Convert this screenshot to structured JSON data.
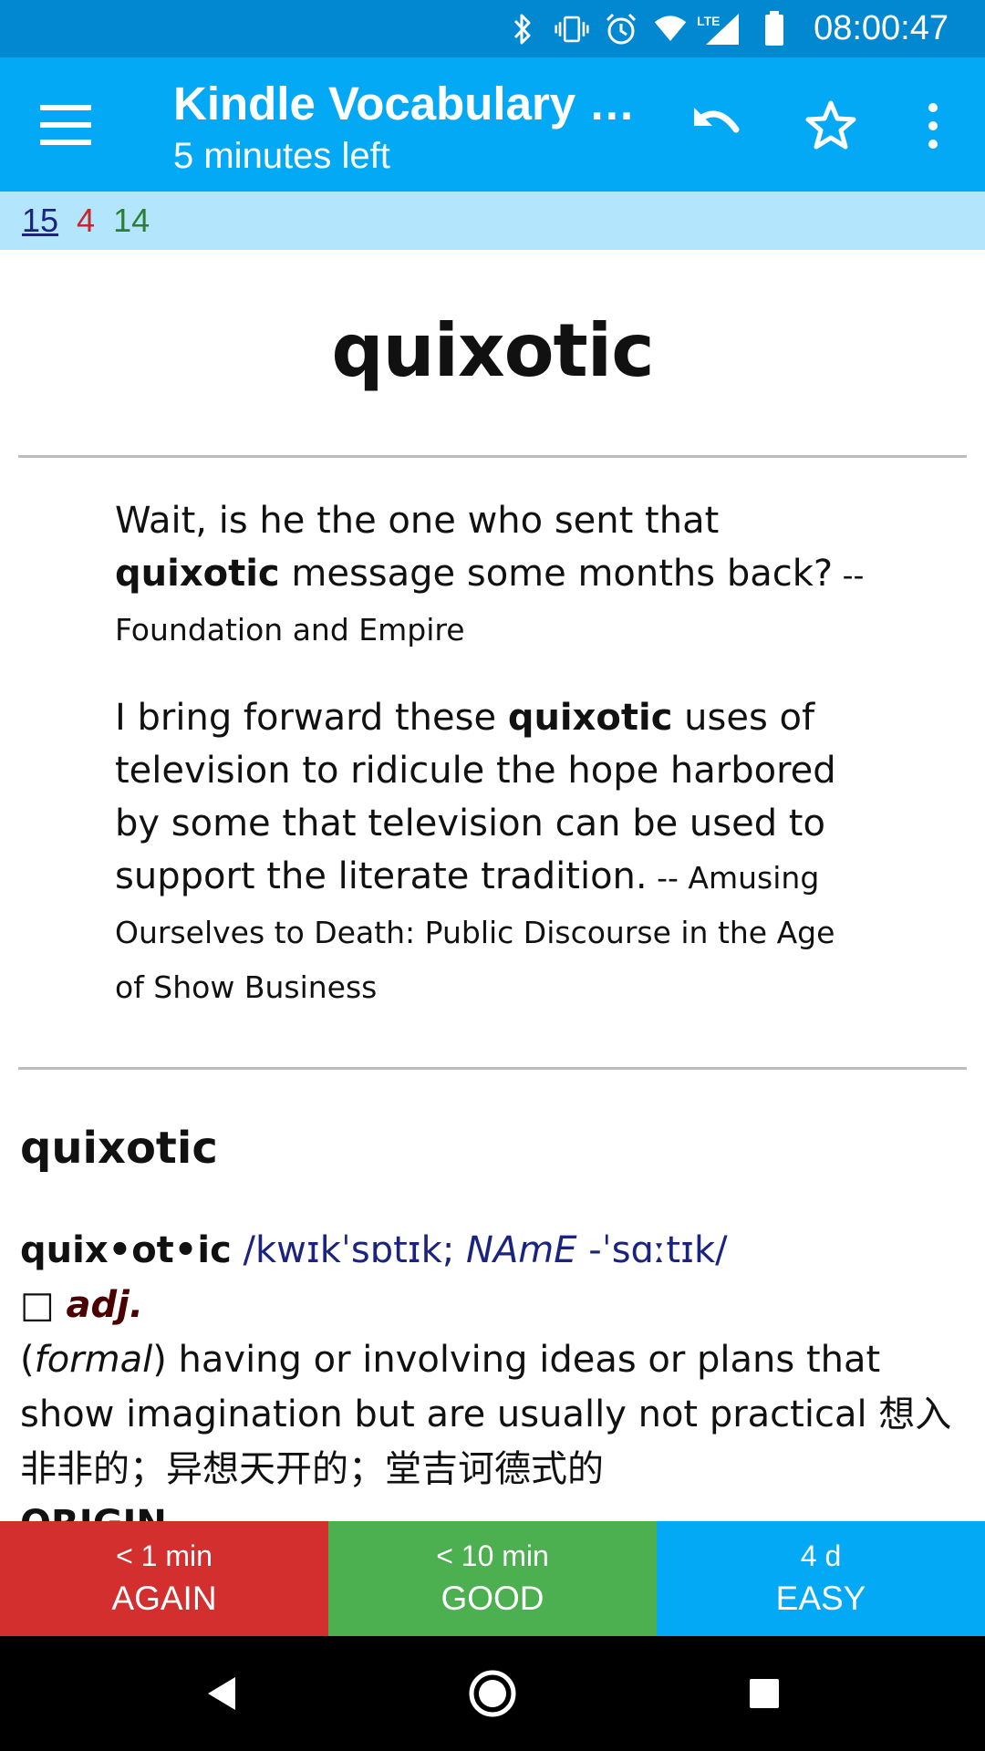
{
  "status_bar": {
    "time": "08:00:47",
    "icons": [
      "bluetooth-icon",
      "vibrate-icon",
      "alarm-icon",
      "wifi-icon",
      "lte-signal-icon",
      "battery-icon"
    ],
    "network_label": "LTE"
  },
  "app_bar": {
    "title": "Kindle Vocabulary B…",
    "subtitle": "5 minutes left",
    "icons": [
      "menu-icon",
      "undo-icon",
      "star-icon",
      "more-vert-icon"
    ]
  },
  "counts": {
    "new": "15",
    "learning": "4",
    "review": "14"
  },
  "card": {
    "word": "quixotic",
    "examples": [
      {
        "before": "Wait, is he the one who sent that ",
        "bold": "quixotic",
        "after": " message some months back?",
        "source": " -- Foundation and Empire"
      },
      {
        "before": "I bring forward these ",
        "bold": "quixotic",
        "after": " uses of television to ridicule the hope harbored by some that television can be used to support the literate tradition.",
        "source": " -- Amusing Ourselves to Death: Public Discourse in the Age of Show Business"
      }
    ],
    "definition": {
      "title": "quixotic",
      "headword": "quix•ot•ic",
      "pron_1": " /kwɪkˈsɒtɪk; ",
      "pron_region": "NAmE",
      "pron_2": " -ˈsɑːtɪk/",
      "pos_box": "□ ",
      "pos": "adj.",
      "register_open": "(",
      "register": "formal",
      "register_close": ")",
      "meaning": " having or involving ideas or plans that show imagination but are usually not practical 想入非非的；异想天开的；堂吉诃德式的",
      "origin_label": "ORIGIN"
    }
  },
  "answers": [
    {
      "interval": "< 1 min",
      "label": "AGAIN"
    },
    {
      "interval": "< 10 min",
      "label": "GOOD"
    },
    {
      "interval": "4 d",
      "label": "EASY"
    }
  ],
  "colors": {
    "status_bar": "#0288d1",
    "app_bar": "#03a9f4",
    "counts_bar": "#b3e5fc",
    "again": "#d32f2f",
    "good": "#4caf50",
    "easy": "#03a9f4"
  }
}
